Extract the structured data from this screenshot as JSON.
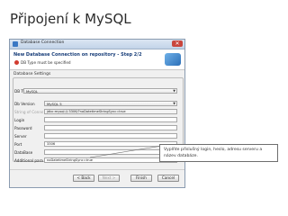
{
  "slide": {
    "title": "Připojení k MySQL"
  },
  "dialog": {
    "window_title": "Database Connection",
    "header": "New Database Connection on repository - Step 2/2",
    "error": "DB Type must be specified",
    "section": "Database Settings",
    "db_type": {
      "label": "DB Type",
      "value": "MySQL"
    },
    "fields": [
      {
        "label": "Db Version",
        "value": "MySQL 5",
        "kind": "select"
      },
      {
        "label": "String of Connection",
        "value": "jdbc:mysql://:3306/?noDatetimeStringSync=true",
        "kind": "readonly"
      },
      {
        "label": "Login",
        "value": "",
        "kind": "text"
      },
      {
        "label": "Password",
        "value": "",
        "kind": "text"
      },
      {
        "label": "Server",
        "value": "",
        "kind": "text"
      },
      {
        "label": "Port",
        "value": "3306",
        "kind": "text"
      },
      {
        "label": "DataBase",
        "value": "",
        "kind": "text"
      },
      {
        "label": "Additional parameters",
        "value": "noDatetimeStringSync=true",
        "kind": "text"
      }
    ],
    "buttons": {
      "back": "< Back",
      "next": "Next >",
      "finish": "Finish",
      "cancel": "Cancel"
    }
  },
  "callout": {
    "text": "Vyplňte příslušný login, heslo, adresu serveru a název databáze."
  }
}
